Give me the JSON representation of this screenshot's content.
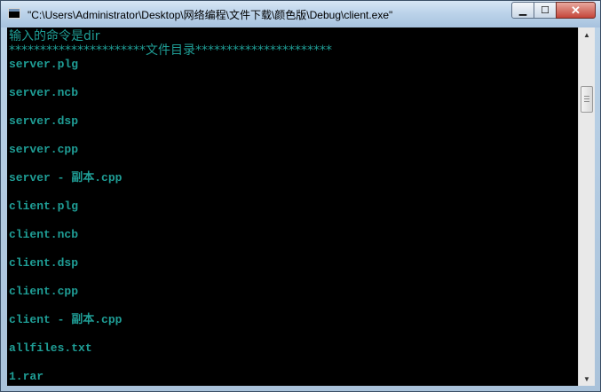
{
  "window": {
    "title": "\"C:\\Users\\Administrator\\Desktop\\网络编程\\文件下载\\颜色版\\Debug\\client.exe\"",
    "controls": {
      "minimize": "▁",
      "maximize": "☐",
      "close": "✕"
    }
  },
  "console": {
    "lines": [
      "输入的命令是dir",
      "**********************文件目录**********************",
      "server.plg",
      "",
      "server.ncb",
      "",
      "server.dsp",
      "",
      "server.cpp",
      "",
      "server - 副本.cpp",
      "",
      "client.plg",
      "",
      "client.ncb",
      "",
      "client.dsp",
      "",
      "client.cpp",
      "",
      "client - 副本.cpp",
      "",
      "allfiles.txt",
      "",
      "1.rar"
    ],
    "text_color": "#1f9e96",
    "background": "#000000"
  },
  "scrollbar": {
    "up_arrow": "▲",
    "down_arrow": "▼"
  }
}
